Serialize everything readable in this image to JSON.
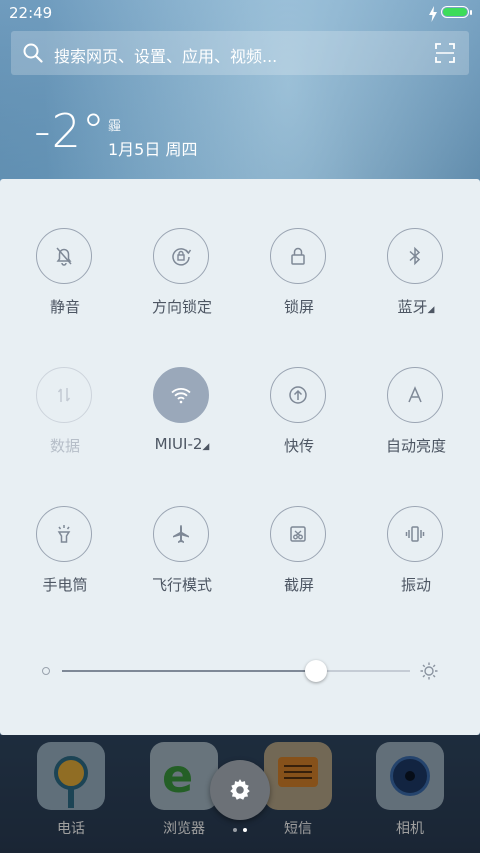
{
  "status_bar": {
    "time": "22:49",
    "battery_color": "#3ddc5a"
  },
  "search": {
    "placeholder": "搜索网页、设置、应用、视频..."
  },
  "weather": {
    "temperature": "-2°",
    "condition": "霾",
    "date": "1月5日 周四"
  },
  "toggles": [
    {
      "label": "静音",
      "icon": "bell-off-icon",
      "state": "off"
    },
    {
      "label": "方向锁定",
      "icon": "rotation-lock-icon",
      "state": "off"
    },
    {
      "label": "锁屏",
      "icon": "lock-icon",
      "state": "off"
    },
    {
      "label": "蓝牙",
      "icon": "bluetooth-icon",
      "state": "off",
      "expandable": true
    },
    {
      "label": "数据",
      "icon": "mobile-data-icon",
      "state": "disabled"
    },
    {
      "label": "MIUI-2",
      "icon": "wifi-icon",
      "state": "on",
      "expandable": true
    },
    {
      "label": "快传",
      "icon": "upload-icon",
      "state": "off"
    },
    {
      "label": "自动亮度",
      "icon": "auto-brightness-icon",
      "state": "off"
    },
    {
      "label": "手电筒",
      "icon": "flashlight-icon",
      "state": "off"
    },
    {
      "label": "飞行模式",
      "icon": "airplane-icon",
      "state": "off"
    },
    {
      "label": "截屏",
      "icon": "screenshot-icon",
      "state": "off"
    },
    {
      "label": "振动",
      "icon": "vibrate-icon",
      "state": "off"
    }
  ],
  "brightness": {
    "level": 0.73
  },
  "dock": [
    {
      "label": "电话",
      "icon": "phone-app-icon"
    },
    {
      "label": "浏览器",
      "icon": "browser-app-icon"
    },
    {
      "label": "短信",
      "icon": "messages-app-icon"
    },
    {
      "label": "相机",
      "icon": "camera-app-icon"
    }
  ],
  "colors": {
    "active_toggle": "#9aa8ba",
    "panel_bg": "#e8eff3"
  }
}
